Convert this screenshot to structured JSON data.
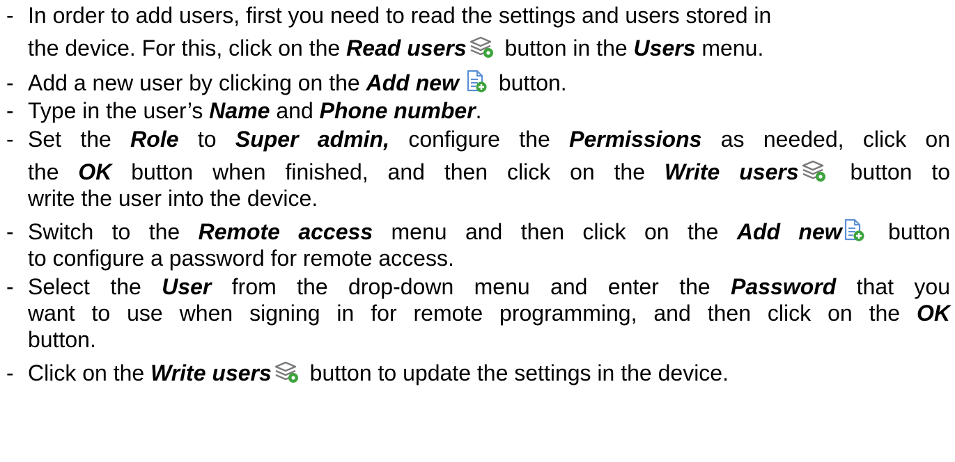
{
  "dash": "-",
  "icons": {
    "users_icon": "users-layers-gear-icon",
    "add_new_icon": "document-add-icon",
    "icon_green": "#3da33d",
    "icon_gray": "#7a7a7a"
  },
  "lines": {
    "l1": {
      "a": "In order to add users, first you need to read the settings and users stored in"
    },
    "l2": {
      "a": "the device. For this, click on the ",
      "b": "Read users",
      "c": " button in the ",
      "d": "Users",
      "e": " menu."
    },
    "l3": {
      "a": "Add a new user by clicking on the ",
      "b": "Add new",
      "c": " button."
    },
    "l4": {
      "a": "Type in the user’s ",
      "b": "Name",
      "c": " and ",
      "d": "Phone number",
      "e": "."
    },
    "l5": {
      "a": "Set the ",
      "b": "Role",
      "c": " to ",
      "d": "Super admin,",
      "e": " configure the ",
      "f": "Permissions",
      "g": " as needed, click on"
    },
    "l6": {
      "a": "the ",
      "b": "OK",
      "c": " button when finished, and then click on the ",
      "d": "Write users",
      "e": " button to"
    },
    "l7": {
      "a": "write the user into the device."
    },
    "l8": {
      "a": "Switch to the ",
      "b": "Remote access",
      "c": " menu and then click on the ",
      "d": "Add new",
      "e": " button"
    },
    "l9": {
      "a": "to configure a password for remote access."
    },
    "l10": {
      "a": "Select the ",
      "b": "User",
      "c": " from the drop-down menu and enter the ",
      "d": "Password",
      "e": " that you"
    },
    "l11": {
      "a": "want to use when signing in for remote programming, and then click on the ",
      "b": "OK"
    },
    "l12": {
      "a": "button."
    },
    "l13": {
      "a": "Click on the ",
      "b": "Write users",
      "c": " button to update the settings in the device."
    }
  }
}
